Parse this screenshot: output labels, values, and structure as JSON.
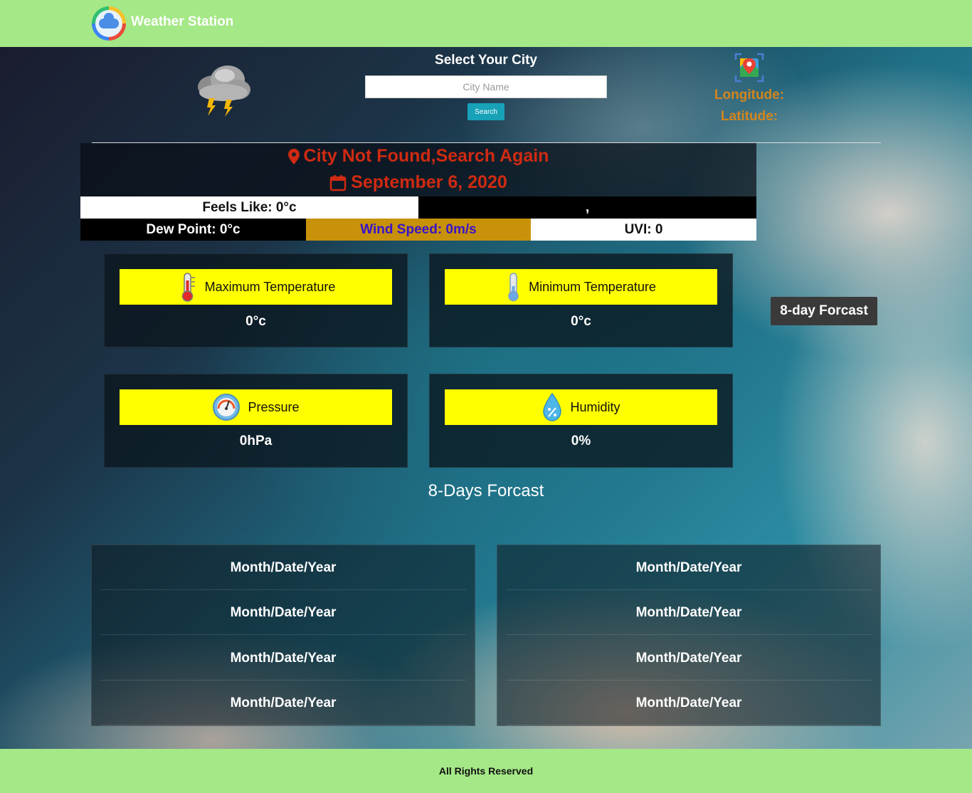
{
  "header": {
    "title": "Weather Station"
  },
  "search": {
    "heading": "Select Your City",
    "placeholder": "City Name",
    "button_label": "Search"
  },
  "location": {
    "longitude_label": "Longitude:",
    "latitude_label": "Latitude:"
  },
  "current": {
    "status": "City Not Found,Search Again",
    "date": "September 6, 2020",
    "feels_like": "Feels Like: 0°c",
    "description": ",",
    "dew_point": "Dew Point: 0°c",
    "wind_speed": "Wind Speed: 0m/s",
    "uvi": "UVI: 0"
  },
  "cards": {
    "max_temp": {
      "label": "Maximum Temperature",
      "value": "0°c"
    },
    "min_temp": {
      "label": "Minimum Temperature",
      "value": "0°c"
    },
    "pressure": {
      "label": "Pressure",
      "value": "0hPa"
    },
    "humidity": {
      "label": "Humidity",
      "value": "0%"
    }
  },
  "forecast_button": "8-day Forcast",
  "forecast": {
    "title": "8-Days Forcast",
    "left": [
      "Month/Date/Year",
      "Month/Date/Year",
      "Month/Date/Year",
      "Month/Date/Year"
    ],
    "right": [
      "Month/Date/Year",
      "Month/Date/Year",
      "Month/Date/Year",
      "Month/Date/Year"
    ]
  },
  "footer": {
    "text": "All Rights Reserved"
  },
  "colors": {
    "bar_green": "#a5e887",
    "error_red": "#d02a12",
    "coord_orange": "#d4851c",
    "card_yellow": "#ffff00",
    "wind_gold": "#c7920a",
    "wind_text": "#3a13c8",
    "search_teal": "#17a2b8"
  }
}
